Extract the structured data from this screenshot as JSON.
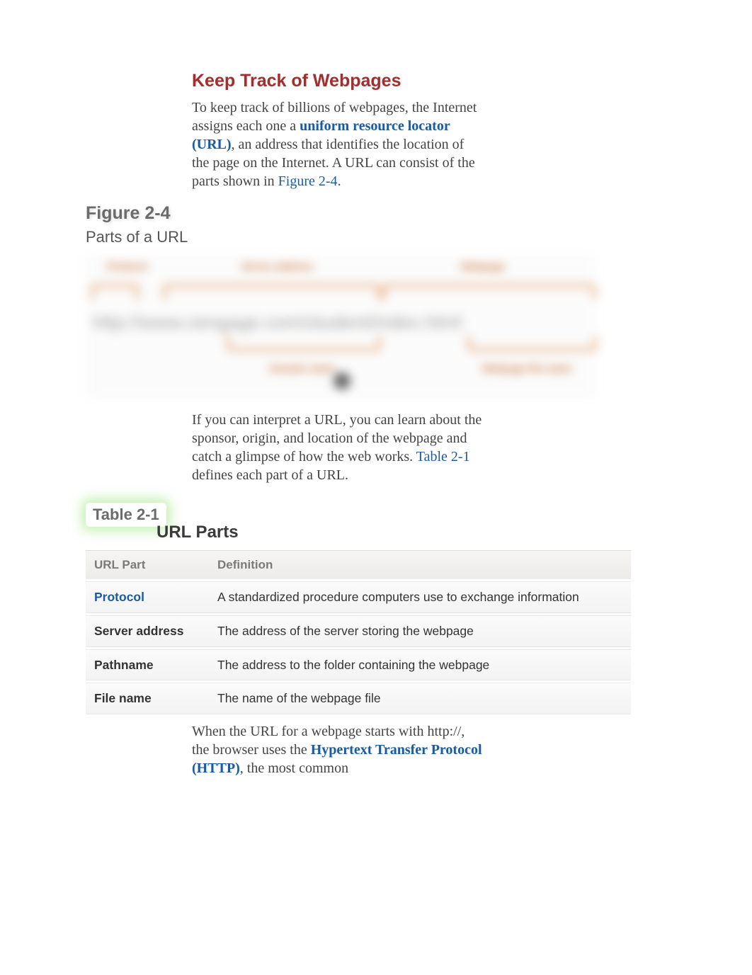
{
  "heading": "Keep Track of Webpages",
  "paragraph1": {
    "pre": "To keep track of billions of webpages, the Internet assigns each one a ",
    "term": "uniform resource locator (URL)",
    "mid": ", an address that identifies the location of the page on the Internet. A URL can consist of the parts shown in ",
    "figref": "Figure 2-4",
    "post": "."
  },
  "figure": {
    "label": "Figure 2-4",
    "caption": "Parts of a URL",
    "labels_top": [
      "Protocol",
      "Server address",
      "Webpage"
    ],
    "labels_bottom": [
      "Domain name",
      "Webpage file name"
    ],
    "url_text": "http://www.cengage.com/student/index.html"
  },
  "paragraph2": {
    "pre": "If you can interpret a URL, you can learn about the sponsor, origin, and location of the webpage and catch a glimpse of how the web works. ",
    "tblref": "Table 2-1",
    "post": " defines each part of a URL."
  },
  "table": {
    "label": "Table 2-1",
    "title": "URL Parts",
    "headers": [
      "URL Part",
      "Definition"
    ],
    "rows": [
      {
        "part": "Protocol",
        "link": true,
        "def": "A standardized procedure computers use to exchange information"
      },
      {
        "part": "Server address",
        "link": false,
        "def": "The address of the server storing the webpage"
      },
      {
        "part": "Pathname",
        "link": false,
        "def": "The address to the folder containing the webpage"
      },
      {
        "part": "File name",
        "link": false,
        "def": "The name of the webpage file"
      }
    ]
  },
  "paragraph3": {
    "pre": "When the URL for a webpage starts with http://, the browser uses the ",
    "term": "Hypertext Transfer Protocol (HTTP)",
    "post": ", the most common"
  }
}
